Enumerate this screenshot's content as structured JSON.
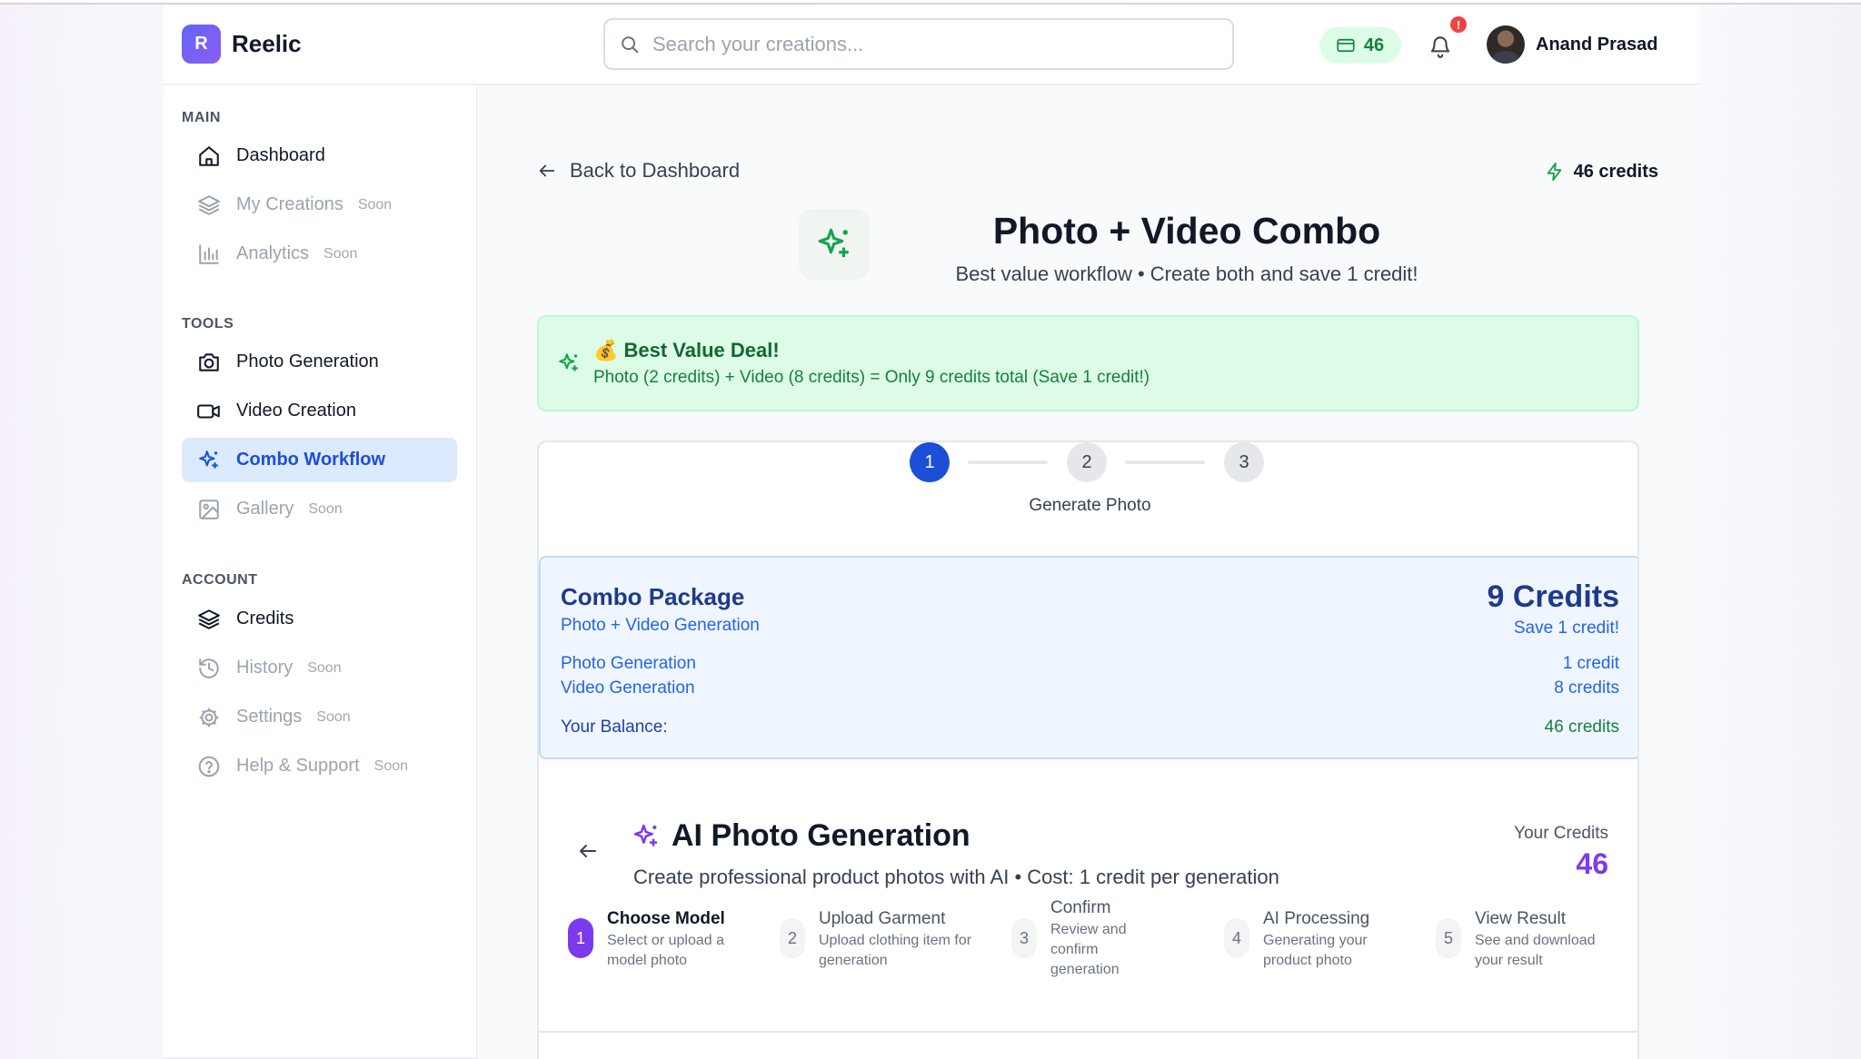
{
  "app": {
    "logo_letter": "R",
    "name": "Reelic"
  },
  "header": {
    "search_placeholder": "Search your creations...",
    "credits": "46",
    "notification_badge": "!",
    "user_name": "Anand Prasad"
  },
  "sidebar": {
    "sections": [
      {
        "title": "MAIN",
        "items": [
          {
            "label": "Dashboard",
            "icon": "home-icon",
            "soon": ""
          },
          {
            "label": "My Creations",
            "icon": "layers-icon",
            "soon": "Soon"
          },
          {
            "label": "Analytics",
            "icon": "bar-chart-icon",
            "soon": "Soon"
          }
        ]
      },
      {
        "title": "TOOLS",
        "items": [
          {
            "label": "Photo Generation",
            "icon": "camera-icon",
            "soon": ""
          },
          {
            "label": "Video Creation",
            "icon": "video-icon",
            "soon": ""
          },
          {
            "label": "Combo Workflow",
            "icon": "sparkles-icon",
            "soon": "",
            "active": true
          },
          {
            "label": "Gallery",
            "icon": "image-icon",
            "soon": "Soon"
          }
        ]
      },
      {
        "title": "ACCOUNT",
        "items": [
          {
            "label": "Credits",
            "icon": "layers-icon",
            "soon": ""
          },
          {
            "label": "History",
            "icon": "history-icon",
            "soon": "Soon"
          },
          {
            "label": "Settings",
            "icon": "gear-icon",
            "soon": "Soon"
          },
          {
            "label": "Help & Support",
            "icon": "help-icon",
            "soon": "Soon"
          }
        ]
      }
    ]
  },
  "main": {
    "back_label": "Back to Dashboard",
    "credits_label": "46 credits",
    "title": "Photo + Video Combo",
    "subtitle": "Best value workflow • Create both and save 1 credit!",
    "deal": {
      "title": "💰 Best Value Deal!",
      "text": "Photo (2 credits) + Video (8 credits) = Only 9 credits total (Save 1 credit!)"
    },
    "stepper": {
      "steps": [
        "1",
        "2",
        "3"
      ],
      "active_step": 1,
      "current_label": "Generate Photo"
    },
    "combo": {
      "title": "Combo Package",
      "subtitle": "Photo + Video Generation",
      "price": "9 Credits",
      "save": "Save 1 credit!",
      "lines": [
        {
          "label": "Photo Generation",
          "value": "1 credit"
        },
        {
          "label": "Video Generation",
          "value": "8 credits"
        }
      ],
      "balance_label": "Your Balance:",
      "balance_value": "46 credits"
    },
    "ai": {
      "title": "AI Photo Generation",
      "subtitle": "Create professional product photos with AI • Cost: 1 credit per generation",
      "your_credits_label": "Your Credits",
      "your_credits_value": "46",
      "steps": [
        {
          "num": "1",
          "title": "Choose Model",
          "desc": "Select or upload a model photo",
          "active": true
        },
        {
          "num": "2",
          "title": "Upload Garment",
          "desc": "Upload clothing item for generation"
        },
        {
          "num": "3",
          "title": "Confirm",
          "desc": "Review and confirm generation"
        },
        {
          "num": "4",
          "title": "AI Processing",
          "desc": "Generating your product photo"
        },
        {
          "num": "5",
          "title": "View Result",
          "desc": "See and download your result"
        }
      ]
    }
  },
  "colors": {
    "accent_blue": "#1d4ed8",
    "accent_purple": "#7c3aed",
    "success_green": "#15803d",
    "alert_red": "#ef4444"
  }
}
